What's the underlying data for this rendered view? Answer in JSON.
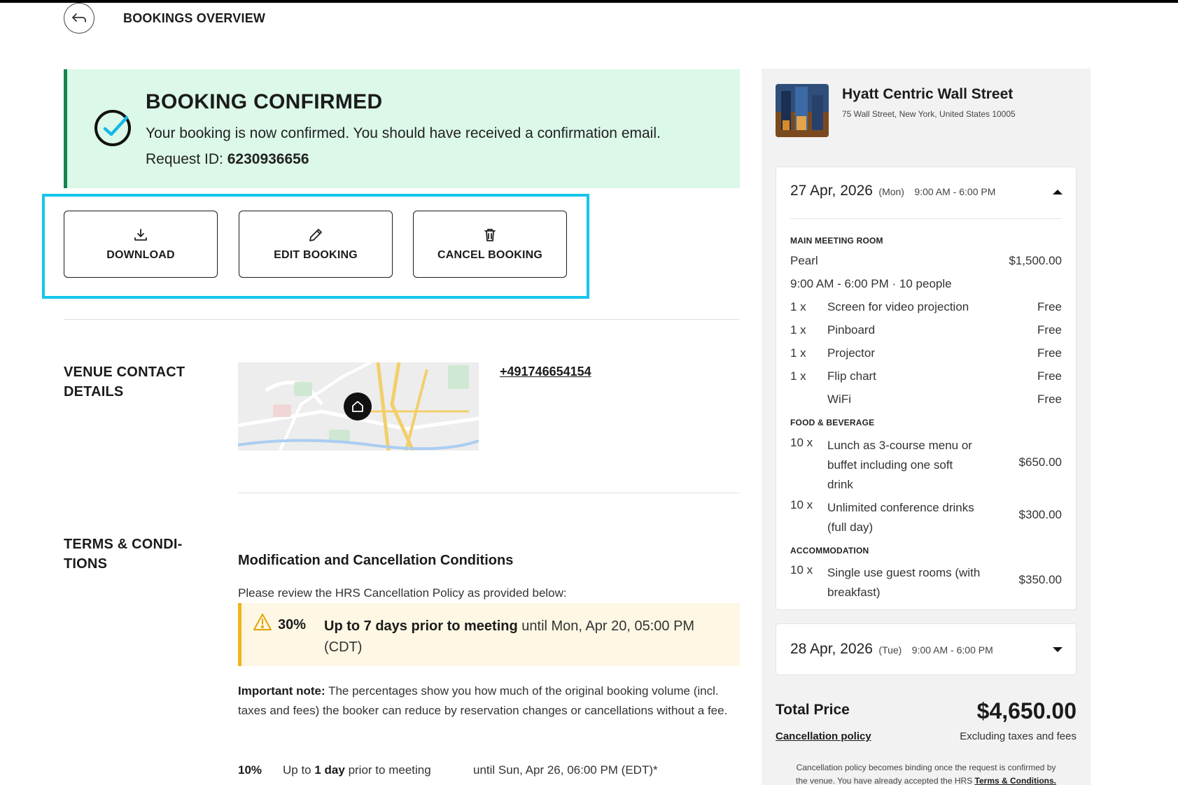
{
  "header": {
    "title": "BOOKINGS OVERVIEW"
  },
  "banner": {
    "title": "BOOKING CONFIRMED",
    "message": "Your booking is now confirmed. You should have received a confirmation email.",
    "request_label": "Request ID: ",
    "request_id": "6230936656"
  },
  "actions": {
    "download": "DOWNLOAD",
    "edit": "EDIT BOOKING",
    "cancel": "CANCEL BOOKING"
  },
  "venue": {
    "title_line1": "VENUE CONTACT",
    "title_line2": "DETAILS",
    "phone": "+491746654154"
  },
  "terms": {
    "title_line1": "TERMS & CONDI-",
    "title_line2": "TIONS",
    "mod_title": "Modification and Cancellation Conditions",
    "intro": "Please review the HRS Cancellation Policy as provided below:",
    "warning": {
      "percent": "30%",
      "bold": "Up to 7 days prior to meeting",
      "rest": " until Mon, Apr 20, 05:00 PM (CDT)"
    },
    "note_bold": "Important note:",
    "note_text": " The percentages show you how much of the original booking volume (incl. taxes and fees) the booker can reduce by reservation changes or cancellations without a fee.",
    "tier": {
      "percent": "10%",
      "pre": "Up to ",
      "bold": "1 day",
      "post": " prior to meeting",
      "until": "until Sun, Apr 26, 06:00 PM (EDT)*"
    }
  },
  "summary": {
    "hotel_name": "Hyatt Centric Wall Street",
    "hotel_address": "75 Wall Street, New York, United States 10005",
    "day1": {
      "date": "27 Apr, 2026",
      "dow": "(Mon)",
      "time": "9:00 AM - 6:00 PM",
      "room_category": "MAIN MEETING ROOM",
      "room_name": "Pearl",
      "room_price": "$1,500.00",
      "room_detail": "9:00 AM - 6:00 PM · 10 people",
      "equipment": [
        {
          "qty": "1 x",
          "name": "Screen for video projection",
          "price": "Free"
        },
        {
          "qty": "1 x",
          "name": "Pinboard",
          "price": "Free"
        },
        {
          "qty": "1 x",
          "name": "Projector",
          "price": "Free"
        },
        {
          "qty": "1 x",
          "name": "Flip chart",
          "price": "Free"
        },
        {
          "qty": "",
          "name": "WiFi",
          "price": "Free"
        }
      ],
      "fb_category": "FOOD & BEVERAGE",
      "fb": [
        {
          "qty": "10 x",
          "l1": "Lunch as 3-course menu or",
          "l2": "buffet including one soft",
          "l3": "drink",
          "price": "$650.00"
        },
        {
          "qty": "10 x",
          "l1": "Unlimited conference drinks",
          "l2": "(full day)",
          "price": "$300.00"
        }
      ],
      "acc_category": "ACCOMMODATION",
      "acc": {
        "qty": "10 x",
        "l1": "Single use guest rooms (with",
        "l2": "breakfast)",
        "price": "$350.00"
      }
    },
    "day2": {
      "date": "28 Apr, 2026",
      "dow": "(Tue)",
      "time": "9:00 AM - 6:00 PM"
    },
    "total_label": "Total Price",
    "total_value": "$4,650.00",
    "cancellation_link": "Cancellation policy",
    "excluding": "Excluding taxes and fees",
    "binding_l1": "Cancellation policy becomes binding once the request is confirmed by",
    "binding_l2_pre": "the venue. You have already accepted the HRS ",
    "binding_l2_link": "Terms & Conditions."
  }
}
